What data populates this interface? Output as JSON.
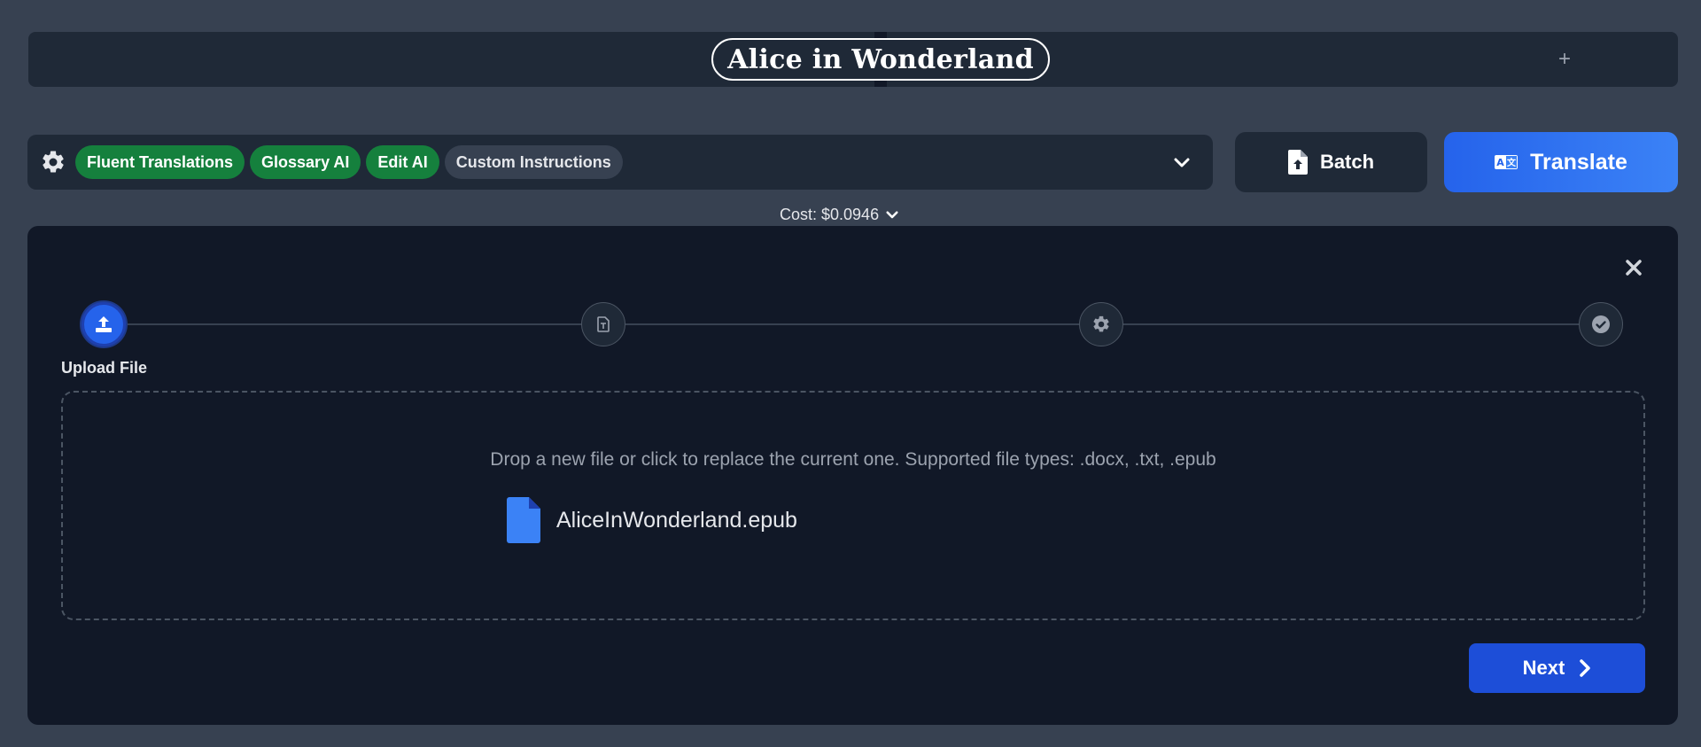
{
  "document": {
    "title": "Alice in Wonderland",
    "add_tab_symbol": "+"
  },
  "toolbar": {
    "settings_icon": "gear-icon",
    "chips": [
      {
        "label": "Fluent Translations",
        "enabled": true
      },
      {
        "label": "Glossary AI",
        "enabled": true
      },
      {
        "label": "Edit AI",
        "enabled": true
      },
      {
        "label": "Custom Instructions",
        "enabled": false
      }
    ],
    "expand_icon": "chevron-down-icon"
  },
  "batch_button": {
    "label": "Batch",
    "icon": "file-upload-icon"
  },
  "translate_button": {
    "label": "Translate",
    "icon": "translate-icon"
  },
  "cost": {
    "label": "Cost: $0.0946"
  },
  "wizard": {
    "steps": [
      {
        "icon": "upload-icon",
        "active": true,
        "label": "Upload File"
      },
      {
        "icon": "file-text-icon",
        "active": false
      },
      {
        "icon": "gear-icon",
        "active": false
      },
      {
        "icon": "check-circle-icon",
        "active": false
      }
    ],
    "dropzone_hint": "Drop a new file or click to replace the current one. Supported file types: .docx, .txt, .epub",
    "file": {
      "name": "AliceInWonderland.epub",
      "icon": "file-icon"
    },
    "next_label": "Next"
  },
  "colors": {
    "background": "#374151",
    "panel": "#111827",
    "chip_enabled": "#15803d",
    "accent": "#2563eb"
  }
}
